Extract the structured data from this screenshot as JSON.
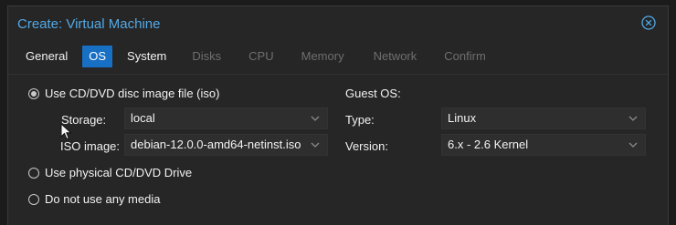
{
  "dialog": {
    "title": "Create: Virtual Machine"
  },
  "tabs": [
    {
      "label": "General",
      "state": "normal"
    },
    {
      "label": "OS",
      "state": "active"
    },
    {
      "label": "System",
      "state": "normal"
    },
    {
      "label": "Disks",
      "state": "disabled"
    },
    {
      "label": "CPU",
      "state": "disabled"
    },
    {
      "label": "Memory",
      "state": "disabled"
    },
    {
      "label": "Network",
      "state": "disabled"
    },
    {
      "label": "Confirm",
      "state": "disabled"
    }
  ],
  "media": {
    "option_iso": {
      "label": "Use CD/DVD disc image file (iso)",
      "checked": true
    },
    "storage": {
      "label": "Storage:",
      "value": "local"
    },
    "iso_image": {
      "label": "ISO image:",
      "value": "debian-12.0.0-amd64-netinst.iso"
    },
    "option_physical": {
      "label": "Use physical CD/DVD Drive",
      "checked": false
    },
    "option_none": {
      "label": "Do not use any media",
      "checked": false
    }
  },
  "guest_os": {
    "heading": "Guest OS:",
    "type": {
      "label": "Type:",
      "value": "Linux"
    },
    "version": {
      "label": "Version:",
      "value": "6.x - 2.6 Kernel"
    }
  },
  "colors": {
    "accent": "#1770c4",
    "title": "#53a9e6",
    "background": "#262626"
  }
}
